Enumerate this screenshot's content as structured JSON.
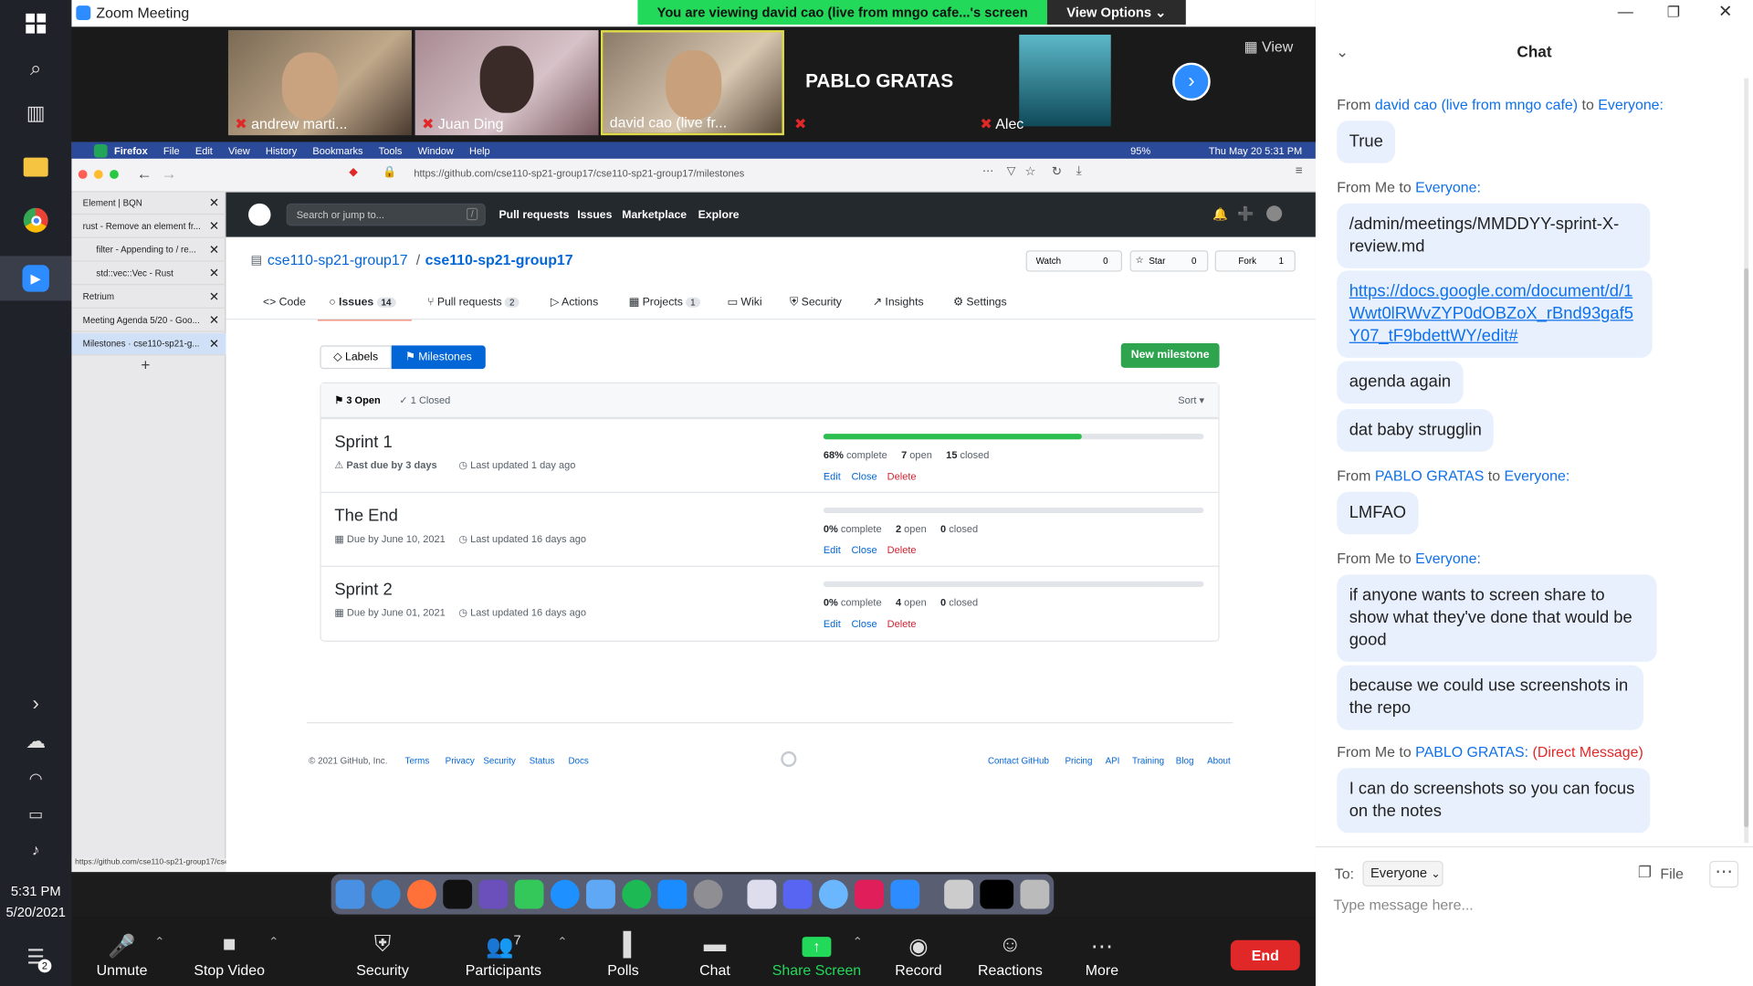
{
  "taskbar": {
    "time": "5:31 PM",
    "date": "5/20/2021",
    "notif_count": "2"
  },
  "zoom": {
    "title": "Zoom Meeting",
    "viewing_banner": "You are viewing david cao (live from mngo cafe...'s screen",
    "view_options": "View Options",
    "view_label": "View",
    "participants": [
      {
        "name": "andrew marti..."
      },
      {
        "name": "Juan Ding"
      },
      {
        "name": "david cao (live fr..."
      },
      {
        "name": "PABLO GRATAS"
      },
      {
        "name": "Alec"
      }
    ],
    "toolbar": {
      "unmute": "Unmute",
      "stop_video": "Stop Video",
      "security": "Security",
      "participants": "Participants",
      "participants_count": "7",
      "polls": "Polls",
      "chat": "Chat",
      "share_screen": "Share Screen",
      "record": "Record",
      "reactions": "Reactions",
      "more": "More",
      "end": "End"
    }
  },
  "mac": {
    "menu": [
      "Firefox",
      "File",
      "Edit",
      "View",
      "History",
      "Bookmarks",
      "Tools",
      "Window",
      "Help"
    ],
    "battery": "95%",
    "clock": "Thu May 20  5:31 PM"
  },
  "firefox": {
    "url": "https://github.com/cse110-sp21-group17/cse110-sp21-group17/milestones",
    "status_url": "https://github.com/cse110-sp21-group17/cse110-sp21-group17/pulls",
    "tabs": [
      {
        "label": "Element | BQN"
      },
      {
        "label": "rust - Remove an element fr..."
      },
      {
        "label": "filter - Appending to / re..."
      },
      {
        "label": "std::vec::Vec - Rust"
      },
      {
        "label": "Retrium"
      },
      {
        "label": "Meeting Agenda 5/20 - Goo..."
      },
      {
        "label": "Milestones · cse110-sp21-g..."
      }
    ],
    "new_tab": "+"
  },
  "github": {
    "search_placeholder": "Search or jump to...",
    "search_key": "/",
    "nav": [
      "Pull requests",
      "Issues",
      "Marketplace",
      "Explore"
    ],
    "owner": "cse110-sp21-group17",
    "sep": "/",
    "repo": "cse110-sp21-group17",
    "watch": {
      "label": "Watch",
      "count": "0"
    },
    "star": {
      "label": "Star",
      "count": "0"
    },
    "fork": {
      "label": "Fork",
      "count": "1"
    },
    "tabs": [
      {
        "label": "Code"
      },
      {
        "label": "Issues",
        "count": "14"
      },
      {
        "label": "Pull requests",
        "count": "2"
      },
      {
        "label": "Actions"
      },
      {
        "label": "Projects",
        "count": "1"
      },
      {
        "label": "Wiki"
      },
      {
        "label": "Security"
      },
      {
        "label": "Insights"
      },
      {
        "label": "Settings"
      }
    ],
    "labels_btn": "Labels",
    "milestones_btn": "Milestones",
    "new_milestone": "New milestone",
    "open_count": "3 Open",
    "closed_count": "1 Closed",
    "sort": "Sort",
    "milestones": [
      {
        "title": "Sprint 1",
        "due": "Past due by 3 days",
        "updated": "Last updated 1 day ago",
        "pct": "68%",
        "complete_label": "complete",
        "open": "7",
        "open_label": "open",
        "closed": "15",
        "closed_label": "closed",
        "progress": 0.68
      },
      {
        "title": "The End",
        "due": "Due by June 10, 2021",
        "updated": "Last updated 16 days ago",
        "pct": "0%",
        "complete_label": "complete",
        "open": "2",
        "open_label": "open",
        "closed": "0",
        "closed_label": "closed",
        "progress": 0
      },
      {
        "title": "Sprint 2",
        "due": "Due by June 01, 2021",
        "updated": "Last updated 16 days ago",
        "pct": "0%",
        "complete_label": "complete",
        "open": "4",
        "open_label": "open",
        "closed": "0",
        "closed_label": "closed",
        "progress": 0
      }
    ],
    "actions": {
      "edit": "Edit",
      "close": "Close",
      "delete": "Delete"
    },
    "footer": {
      "copyright": "© 2021 GitHub, Inc.",
      "left": [
        "Terms",
        "Privacy",
        "Security",
        "Status",
        "Docs"
      ],
      "right": [
        "Contact GitHub",
        "Pricing",
        "API",
        "Training",
        "Blog",
        "About"
      ]
    }
  },
  "chat": {
    "title": "Chat",
    "to_label": "To:",
    "to_value": "Everyone",
    "file": "File",
    "placeholder": "Type message here...",
    "from_word": "From",
    "to_word": "to",
    "me": "Me",
    "everyone": "Everyone:",
    "senders": {
      "david": "david cao (live from mngo cafe)",
      "pablo": "PABLO GRATAS",
      "pablo_dm": "PABLO GRATAS:",
      "dm": "(Direct Message)"
    },
    "messages": {
      "m1": "True",
      "m2": "/admin/meetings/MMDDYY-sprint-X-review.md",
      "m3": "https://docs.google.com/document/d/1Wwt0lRWvZYP0dOBZoX_rBnd93gaf5Y07_tF9bdettWY/edit#",
      "m4": "agenda again",
      "m5": "dat baby strugglin",
      "m6": "LMFAO",
      "m7": "if anyone wants to screen share to show what they've done that would be good",
      "m8": "because we could use screenshots in the repo",
      "m9": "I can do screenshots so you can focus on the notes"
    }
  },
  "colors": {
    "zoom_blue": "#0e71eb",
    "share_green": "#23d959",
    "end_red": "#e02828",
    "gh_dark": "#24292e",
    "gh_green": "#2cbe4e"
  }
}
